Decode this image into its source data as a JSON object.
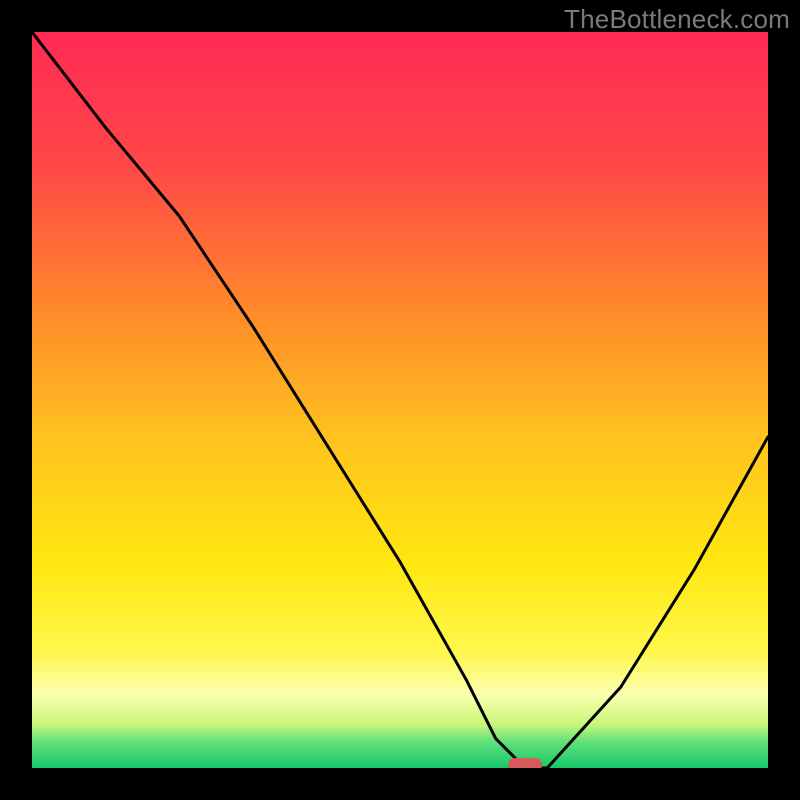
{
  "watermark": "TheBottleneck.com",
  "chart_data": {
    "type": "line",
    "title": "",
    "xlabel": "",
    "ylabel": "",
    "xlim": [
      0,
      100
    ],
    "ylim": [
      0,
      100
    ],
    "grid": false,
    "series": [
      {
        "name": "curve",
        "x": [
          0,
          10,
          20,
          30,
          40,
          50,
          59,
          63,
          67,
          70,
          80,
          90,
          100
        ],
        "y": [
          100,
          87,
          75,
          60,
          44,
          28,
          12,
          4,
          0,
          0,
          11,
          27,
          45
        ]
      }
    ],
    "marker": {
      "x": 67,
      "y": 0
    },
    "gradient_stops": [
      {
        "offset": 0.0,
        "color": "#ff2a55"
      },
      {
        "offset": 0.18,
        "color": "#ff4747"
      },
      {
        "offset": 0.38,
        "color": "#ff8a2a"
      },
      {
        "offset": 0.55,
        "color": "#ffc21f"
      },
      {
        "offset": 0.72,
        "color": "#ffe70f"
      },
      {
        "offset": 0.84,
        "color": "#fff74a"
      },
      {
        "offset": 0.9,
        "color": "#fbffb0"
      },
      {
        "offset": 0.94,
        "color": "#c9f77a"
      },
      {
        "offset": 0.965,
        "color": "#5fe07a"
      },
      {
        "offset": 1.0,
        "color": "#18c86a"
      }
    ],
    "curve_color": "#000000",
    "marker_color": "#d65a5a"
  }
}
